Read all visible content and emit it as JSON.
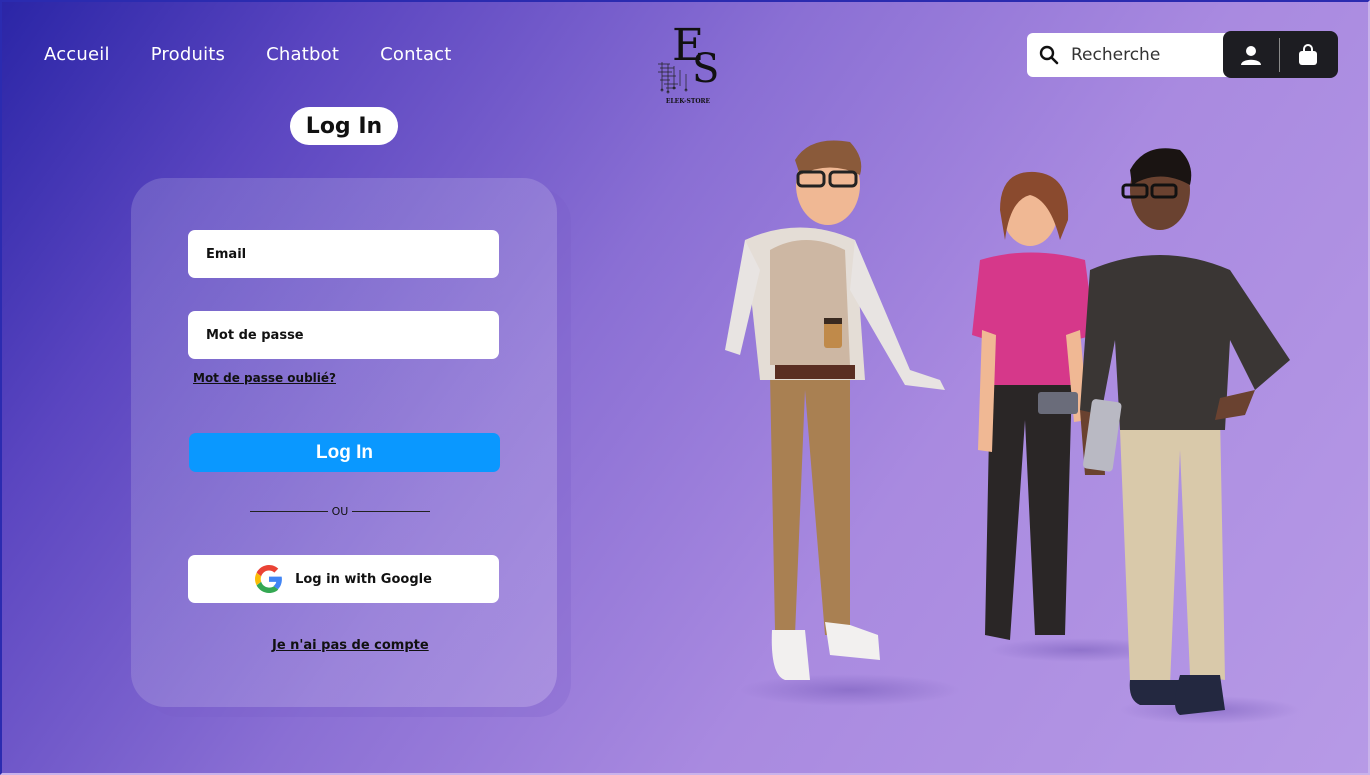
{
  "nav": {
    "items": [
      {
        "label": "Accueil"
      },
      {
        "label": "Produits"
      },
      {
        "label": "Chatbot"
      },
      {
        "label": "Contact"
      }
    ]
  },
  "logo": {
    "monogram": "ES",
    "caption": "ELEK-STORE"
  },
  "header": {
    "search_placeholder": "Recherche",
    "search_icon": "search-icon",
    "user_icon": "user-icon",
    "bag_icon": "shopping-bag-icon"
  },
  "login": {
    "title": "Log In",
    "email_placeholder": "Email",
    "password_placeholder": "Mot de passe",
    "forgot_label": "Mot de passe oublié?",
    "submit_label": "Log In",
    "divider_label": "OU",
    "google_label": "Log in with Google",
    "no_account_label": "Je n'ai pas de compte"
  },
  "colors": {
    "accent": "#0a98ff",
    "dark_button": "#1d1d22",
    "bg_start": "#2a25a6",
    "bg_end": "#b79ae6"
  }
}
